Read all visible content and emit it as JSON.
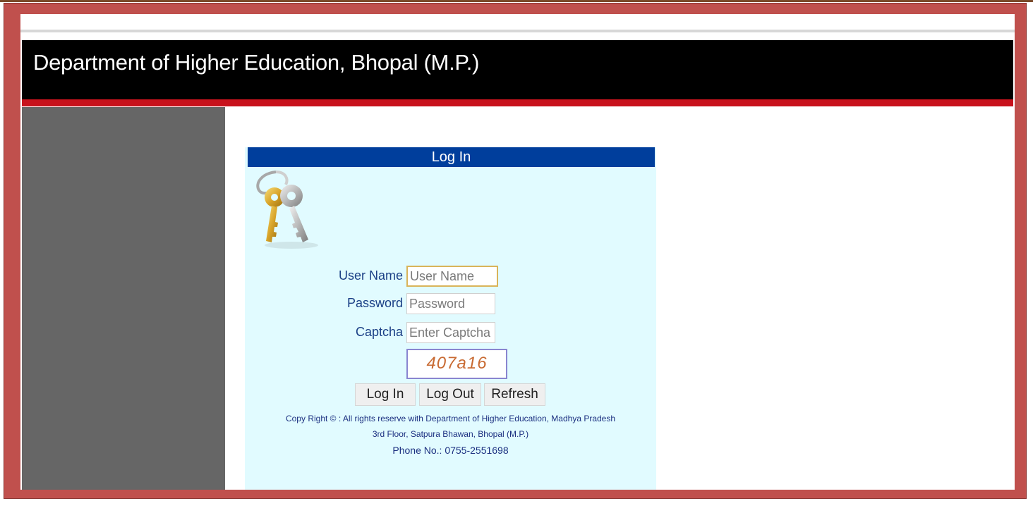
{
  "header": {
    "title": "Department of Higher Education, Bhopal (M.P.)"
  },
  "login": {
    "title": "Log In",
    "icon": "keys-icon",
    "username": {
      "label": "User Name",
      "placeholder": "User Name"
    },
    "password": {
      "label": "Password",
      "placeholder": "Password"
    },
    "captcha": {
      "label": "Captcha",
      "placeholder": "Enter Captcha",
      "code": "407a16"
    },
    "buttons": {
      "login": "Log In",
      "logout": "Log Out",
      "refresh": "Refresh"
    },
    "footer": {
      "copyright": "Copy Right © : All rights reserve with Department of Higher Education, Madhya Pradesh",
      "address": "3rd Floor, Satpura Bhawan, Bhopal (M.P.)",
      "phone": "Phone No.: 0755-2551698"
    }
  },
  "colors": {
    "frame": "#c0504d",
    "header_bg": "#000000",
    "accent_bar": "#c8121c",
    "sidebar": "#666666",
    "login_header": "#003e9c",
    "login_panel": "#e1fbff"
  }
}
